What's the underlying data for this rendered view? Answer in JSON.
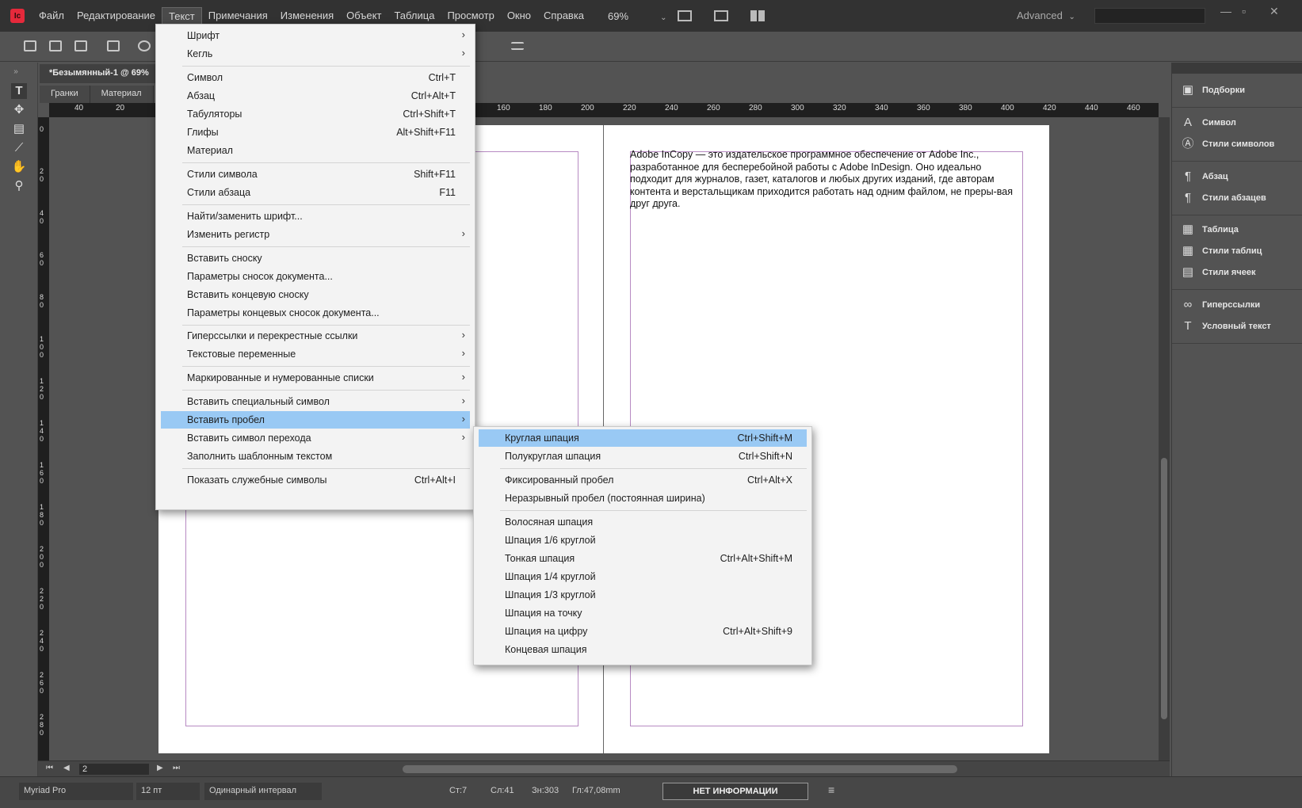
{
  "menubar": {
    "logo": "Ic",
    "items": [
      "Файл",
      "Редактирование",
      "Текст",
      "Примечания",
      "Изменения",
      "Объект",
      "Таблица",
      "Просмотр",
      "Окно",
      "Справка"
    ],
    "zoom": "69%",
    "workspace": "Advanced"
  },
  "document": {
    "tab_title": "*Безымянный-1 @ 69%",
    "subtabs": [
      "Гранки",
      "Материал"
    ],
    "body_text": "Adobe InCopy — это издательское программное обеспечение от Adobe Inc., разработанное для бесперебойной работы с Adobe InDesign. Оно идеально подходит для журналов, газет, каталогов и любых других изданий, где авторам контента и верстальщикам приходится работать над одним файлом, не преры-вая друг друга."
  },
  "ruler": {
    "h_left": [
      "40",
      "20"
    ],
    "h_right": [
      "160",
      "180",
      "200",
      "220",
      "240",
      "260",
      "280",
      "300",
      "320",
      "340",
      "360",
      "380",
      "400",
      "420",
      "440",
      "460"
    ],
    "v": [
      "0",
      "20",
      "40",
      "60",
      "80",
      "100",
      "120",
      "140",
      "160",
      "180",
      "200",
      "220",
      "240",
      "260",
      "280"
    ]
  },
  "text_menu": {
    "items": [
      {
        "label": "Шрифт",
        "shortcut": "",
        "submenu": true
      },
      {
        "label": "Кегль",
        "shortcut": "",
        "submenu": true
      },
      {
        "label": "Символ",
        "shortcut": "Ctrl+T",
        "submenu": false
      },
      {
        "label": "Абзац",
        "shortcut": "Ctrl+Alt+T",
        "submenu": false
      },
      {
        "label": "Табуляторы",
        "shortcut": "Ctrl+Shift+T",
        "submenu": false
      },
      {
        "label": "Глифы",
        "shortcut": "Alt+Shift+F11",
        "submenu": false
      },
      {
        "label": "Материал",
        "shortcut": "",
        "submenu": false
      },
      {
        "label": "Стили символа",
        "shortcut": "Shift+F11",
        "submenu": false
      },
      {
        "label": "Стили абзаца",
        "shortcut": "F11",
        "submenu": false
      },
      {
        "label": "Найти/заменить шрифт...",
        "shortcut": "",
        "submenu": false
      },
      {
        "label": "Изменить регистр",
        "shortcut": "",
        "submenu": true
      },
      {
        "label": "Вставить сноску",
        "shortcut": "",
        "submenu": false
      },
      {
        "label": "Параметры сносок документа...",
        "shortcut": "",
        "submenu": false
      },
      {
        "label": "Вставить концевую сноску",
        "shortcut": "",
        "submenu": false
      },
      {
        "label": "Параметры концевых сносок документа...",
        "shortcut": "",
        "submenu": false
      },
      {
        "label": "Гиперссылки и перекрестные ссылки",
        "shortcut": "",
        "submenu": true
      },
      {
        "label": "Текстовые переменные",
        "shortcut": "",
        "submenu": true
      },
      {
        "label": "Маркированные и нумерованные списки",
        "shortcut": "",
        "submenu": true
      },
      {
        "label": "Вставить специальный символ",
        "shortcut": "",
        "submenu": true
      },
      {
        "label": "Вставить пробел",
        "shortcut": "",
        "submenu": true
      },
      {
        "label": "Вставить символ перехода",
        "shortcut": "",
        "submenu": true
      },
      {
        "label": "Заполнить шаблонным текстом",
        "shortcut": "",
        "submenu": false
      },
      {
        "label": "Показать служебные символы",
        "shortcut": "Ctrl+Alt+I",
        "submenu": false
      }
    ]
  },
  "space_submenu": {
    "items": [
      {
        "label": "Круглая шпация",
        "shortcut": "Ctrl+Shift+M"
      },
      {
        "label": "Полукруглая шпация",
        "shortcut": "Ctrl+Shift+N"
      },
      {
        "label": "Фиксированный пробел",
        "shortcut": "Ctrl+Alt+X"
      },
      {
        "label": "Неразрывный пробел (постоянная ширина)",
        "shortcut": ""
      },
      {
        "label": "Волосяная шпация",
        "shortcut": ""
      },
      {
        "label": "Шпация 1/6 круглой",
        "shortcut": ""
      },
      {
        "label": "Тонкая шпация",
        "shortcut": "Ctrl+Alt+Shift+M"
      },
      {
        "label": "Шпация 1/4 круглой",
        "shortcut": ""
      },
      {
        "label": "Шпация 1/3 круглой",
        "shortcut": ""
      },
      {
        "label": "Шпация на точку",
        "shortcut": ""
      },
      {
        "label": "Шпация на цифру",
        "shortcut": "Ctrl+Alt+Shift+9"
      },
      {
        "label": "Концевая шпация",
        "shortcut": ""
      }
    ]
  },
  "right_panel": {
    "items": [
      {
        "label": "Подборки",
        "icon": "collections-icon"
      },
      {
        "label": "Символ",
        "icon": "character-icon"
      },
      {
        "label": "Стили символов",
        "icon": "character-styles-icon"
      },
      {
        "label": "Абзац",
        "icon": "paragraph-icon"
      },
      {
        "label": "Стили абзацев",
        "icon": "paragraph-styles-icon"
      },
      {
        "label": "Таблица",
        "icon": "table-icon"
      },
      {
        "label": "Стили таблиц",
        "icon": "table-styles-icon"
      },
      {
        "label": "Стили ячеек",
        "icon": "cell-styles-icon"
      },
      {
        "label": "Гиперссылки",
        "icon": "hyperlinks-icon"
      },
      {
        "label": "Условный текст",
        "icon": "conditional-text-icon"
      }
    ]
  },
  "navigation": {
    "page": "2"
  },
  "statusbar": {
    "font": "Myriad Pro",
    "size": "12 пт",
    "leading": "Одинарный интервал",
    "line": "Ст:7",
    "words": "Сл:41",
    "chars": "Зн:303",
    "depth": "Гл:47,08mm",
    "info": "НЕТ ИНФОРМАЦИИ"
  },
  "colors": {
    "highlight": "#99c9f4",
    "margin": "#b78ac2",
    "logo": "#e5293b"
  }
}
